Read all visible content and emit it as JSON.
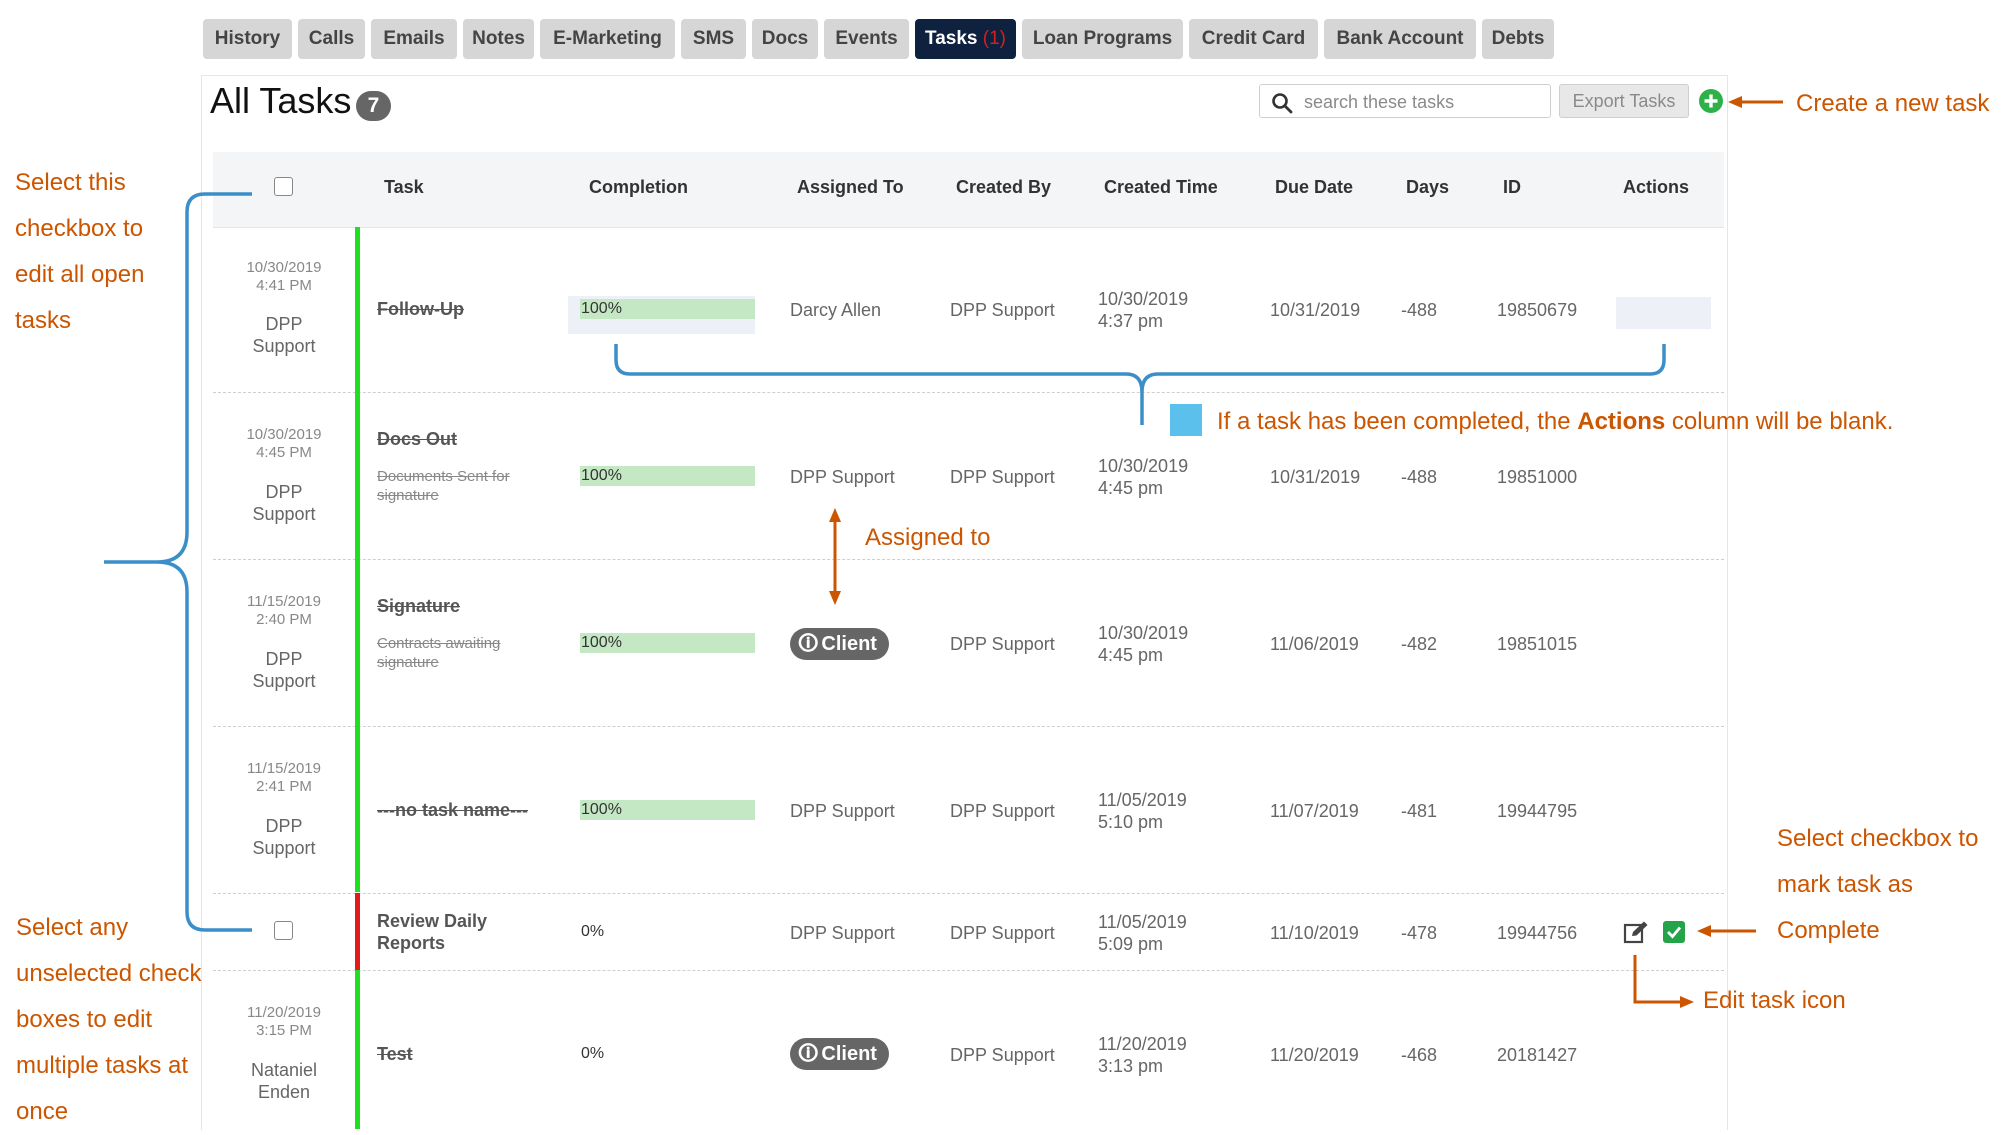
{
  "tabs": [
    {
      "label": "History"
    },
    {
      "label": "Calls"
    },
    {
      "label": "Emails"
    },
    {
      "label": "Notes"
    },
    {
      "label": "E-Marketing"
    },
    {
      "label": "SMS"
    },
    {
      "label": "Docs"
    },
    {
      "label": "Events"
    },
    {
      "label": "Tasks",
      "badge": "(1)",
      "active": true
    },
    {
      "label": "Loan Programs"
    },
    {
      "label": "Credit Card"
    },
    {
      "label": "Bank Account"
    },
    {
      "label": "Debts"
    }
  ],
  "header": {
    "title": "All Tasks",
    "count": "7",
    "search_placeholder": "search these tasks",
    "export_label": "Export Tasks",
    "add_icon": "plus-circle-icon"
  },
  "columns": [
    "Task",
    "Completion",
    "Assigned To",
    "Created By",
    "Created Time",
    "Due Date",
    "Days",
    "ID",
    "Actions"
  ],
  "rows": [
    {
      "meta_date": "10/30/2019",
      "meta_time": "4:41 PM",
      "meta_author_1": "DPP",
      "meta_author_2": "Support",
      "status": "green",
      "task": "Follow-Up",
      "sub": "",
      "completed": true,
      "completion": "100%",
      "assigned": "Darcy Allen",
      "created_by": "DPP Support",
      "created_date": "10/30/2019",
      "created_time": "4:37 pm",
      "due": "10/31/2019",
      "days": "-488",
      "id": "19850679"
    },
    {
      "meta_date": "10/30/2019",
      "meta_time": "4:45 PM",
      "meta_author_1": "DPP",
      "meta_author_2": "Support",
      "status": "green",
      "task": "Docs Out",
      "sub": "Documents Sent for signature",
      "completed": true,
      "completion": "100%",
      "assigned": "DPP Support",
      "created_by": "DPP Support",
      "created_date": "10/30/2019",
      "created_time": "4:45 pm",
      "due": "10/31/2019",
      "days": "-488",
      "id": "19851000"
    },
    {
      "meta_date": "11/15/2019",
      "meta_time": "2:40 PM",
      "meta_author_1": "DPP",
      "meta_author_2": "Support",
      "status": "green",
      "task": "Signature",
      "sub": "Contracts awaiting signature",
      "completed": true,
      "completion": "100%",
      "assigned": "Client",
      "assigned_icon": "person-icon",
      "created_by": "DPP Support",
      "created_date": "10/30/2019",
      "created_time": "4:45 pm",
      "due": "11/06/2019",
      "days": "-482",
      "id": "19851015"
    },
    {
      "meta_date": "11/15/2019",
      "meta_time": "2:41 PM",
      "meta_author_1": "DPP",
      "meta_author_2": "Support",
      "status": "green",
      "task": "---no task name---",
      "sub": "",
      "completed": true,
      "completion": "100%",
      "assigned": "DPP Support",
      "created_by": "DPP Support",
      "created_date": "11/05/2019",
      "created_time": "5:10 pm",
      "due": "11/07/2019",
      "days": "-481",
      "id": "19944795"
    },
    {
      "meta_date": "",
      "meta_time": "",
      "meta_author_1": "",
      "meta_author_2": "",
      "status": "red",
      "task": "Review Daily",
      "task_2": "Reports",
      "sub": "",
      "completed": false,
      "completion": "0%",
      "assigned": "DPP Support",
      "created_by": "DPP Support",
      "created_date": "11/05/2019",
      "created_time": "5:09 pm",
      "due": "11/10/2019",
      "days": "-478",
      "id": "19944756",
      "actions": [
        "edit-icon",
        "complete-checkbox-icon"
      ]
    },
    {
      "meta_date": "11/20/2019",
      "meta_time": "3:15 PM",
      "meta_author_1": "Nataniel",
      "meta_author_2": "Enden",
      "status": "green",
      "task": "Test",
      "sub": "",
      "completed": true,
      "completion": "0%",
      "assigned": "Client",
      "assigned_icon": "person-icon",
      "created_by": "DPP Support",
      "created_date": "11/20/2019",
      "created_time": "3:13 pm",
      "due": "11/20/2019",
      "days": "-468",
      "id": "20181427"
    }
  ],
  "annotations": {
    "create_task": "Create a new task",
    "select_all": [
      "Select this",
      "checkbox to",
      "edit all open",
      "tasks"
    ],
    "actions_blank_prefix": "If a task has been completed, the ",
    "actions_blank_bold": "Actions",
    "actions_blank_suffix": " column will be blank.",
    "assigned_to": "Assigned to",
    "select_any": [
      "Select any",
      "unselected check",
      "boxes to edit",
      "multiple tasks at",
      "once"
    ],
    "mark_complete": [
      "Select checkbox to",
      "mark task as",
      "Complete"
    ],
    "edit_icon": "Edit task icon"
  },
  "colors": {
    "annotation": "#cc5500",
    "bracket": "#3a8fc9",
    "active_tab": "#0e2240",
    "status_green": "#1fe01f",
    "status_red": "#e21a1a",
    "progress": "#c4e7c4"
  }
}
